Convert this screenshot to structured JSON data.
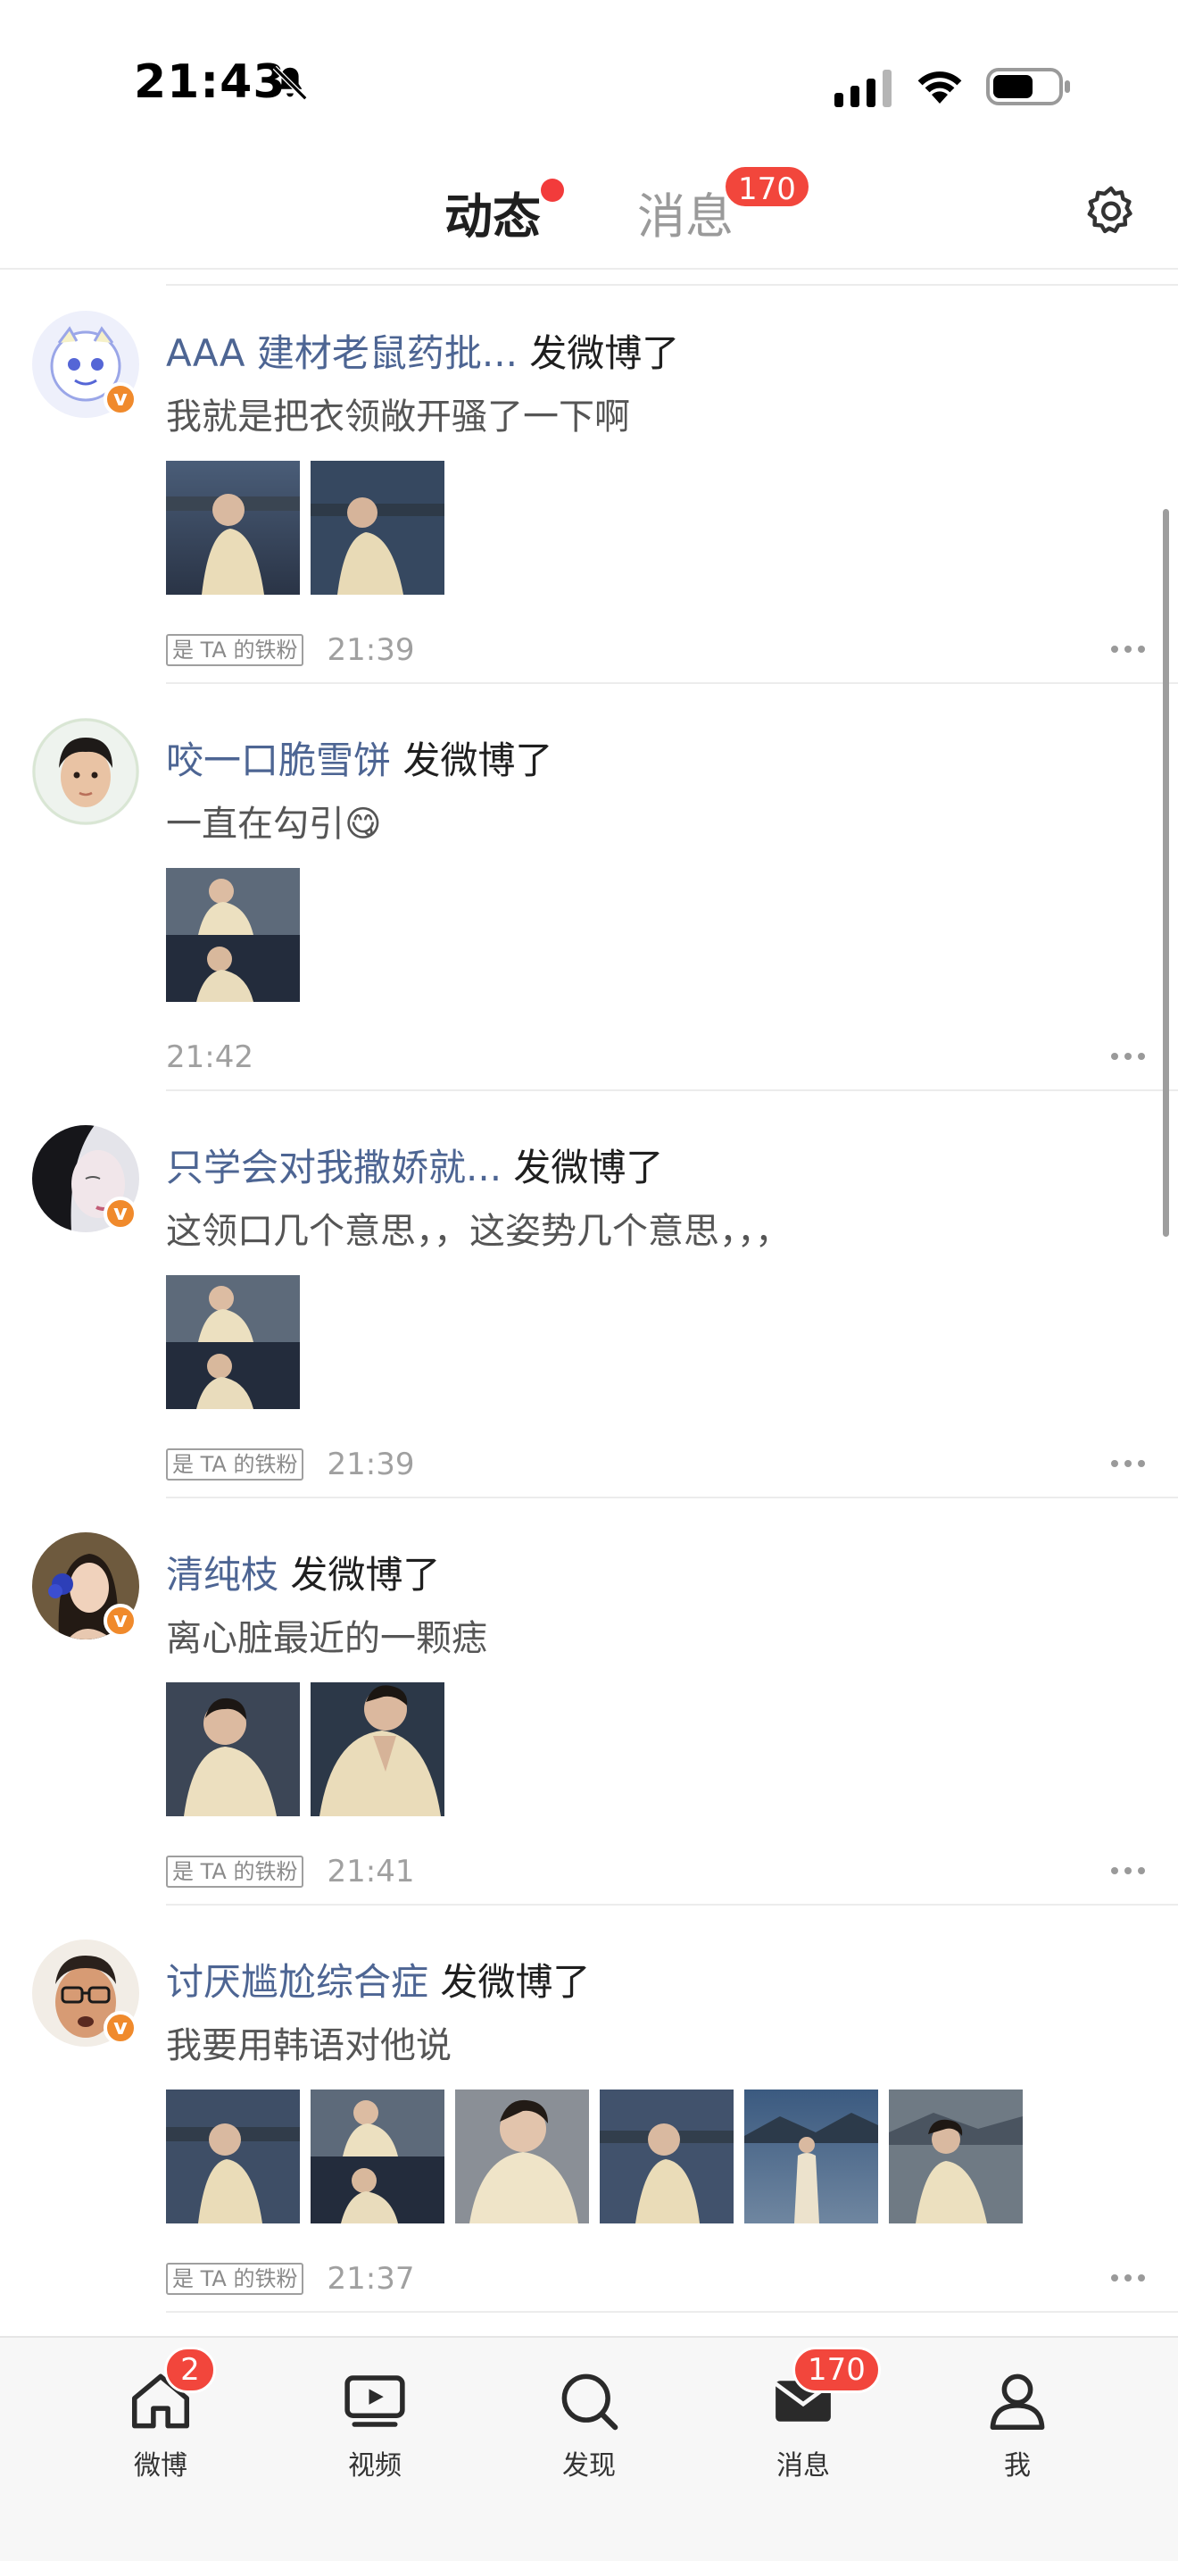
{
  "status_bar": {
    "time": "21:43"
  },
  "top_tabs": {
    "active_label": "动态",
    "inactive_label": "消息",
    "inactive_badge": "170"
  },
  "feed": [
    {
      "username": "AAA 建材老鼠药批...",
      "action": "发微博了",
      "content": "我就是把衣领敞开骚了一下啊",
      "fan_tag": "是 TA 的铁粉",
      "time": "21:39",
      "image_count": 2,
      "verified": true
    },
    {
      "username": "咬一口脆雪饼",
      "action": "发微博了",
      "content": "一直在勾引😋",
      "fan_tag": "",
      "time": "21:42",
      "image_count": 1,
      "verified": false
    },
    {
      "username": "只学会对我撒娇就...",
      "action": "发微博了",
      "content": "这领口几个意思，，这姿势几个意思，，，",
      "fan_tag": "是 TA 的铁粉",
      "time": "21:39",
      "image_count": 1,
      "verified": true
    },
    {
      "username": "清纯枝",
      "action": "发微博了",
      "content": "离心脏最近的一颗痣",
      "fan_tag": "是 TA 的铁粉",
      "time": "21:41",
      "image_count": 2,
      "verified": true
    },
    {
      "username": "讨厌尴尬综合症",
      "action": "发微博了",
      "content": "我要用韩语对他说",
      "fan_tag": "是 TA 的铁粉",
      "time": "21:37",
      "image_count": 6,
      "verified": true
    }
  ],
  "bottom_nav": {
    "home": {
      "label": "微博",
      "badge": "2"
    },
    "video": {
      "label": "视频"
    },
    "discover": {
      "label": "发现"
    },
    "messages": {
      "label": "消息",
      "badge": "170"
    },
    "me": {
      "label": "我"
    }
  },
  "colors": {
    "username": "#4d6593",
    "accent_orange": "#f5a623",
    "badge_red": "#f2463c",
    "verified_orange": "#f08a2c"
  }
}
